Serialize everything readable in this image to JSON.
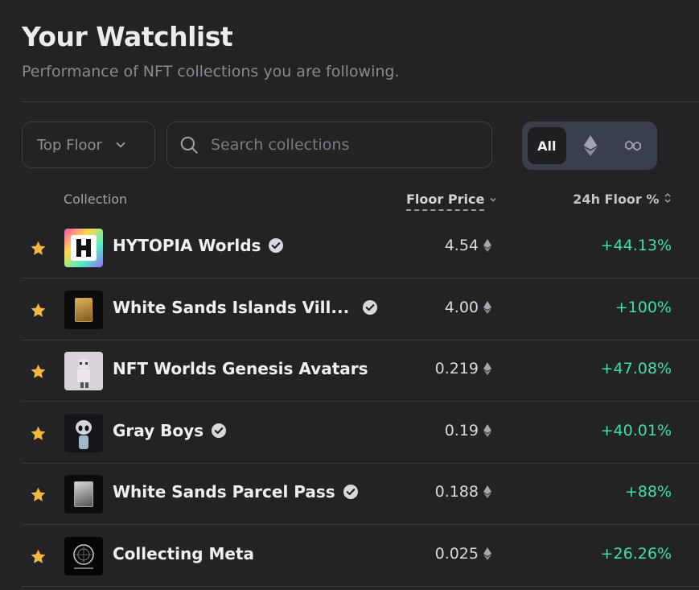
{
  "header": {
    "title": "Your Watchlist",
    "subtitle": "Performance of NFT collections you are following."
  },
  "controls": {
    "sort_label": "Top Floor",
    "search_placeholder": "Search collections",
    "chain_filter": {
      "all_label": "All",
      "selected": "All",
      "options": [
        "all",
        "ethereum-icon",
        "polygon-icon"
      ]
    }
  },
  "table": {
    "columns": {
      "collection": "Collection",
      "floor": "Floor Price",
      "change": "24h Floor %"
    },
    "rows": [
      {
        "name": "HYTOPIA Worlds",
        "verified": true,
        "floor": "4.54",
        "change": "+44.13%"
      },
      {
        "name": "White Sands Islands Vill...",
        "verified": true,
        "floor": "4.00",
        "change": "+100%"
      },
      {
        "name": "NFT Worlds Genesis Avatars",
        "verified": false,
        "floor": "0.219",
        "change": "+47.08%"
      },
      {
        "name": "Gray Boys",
        "verified": true,
        "floor": "0.19",
        "change": "+40.01%"
      },
      {
        "name": "White Sands Parcel Pass",
        "verified": true,
        "floor": "0.188",
        "change": "+88%"
      },
      {
        "name": "Collecting Meta",
        "verified": false,
        "floor": "0.025",
        "change": "+26.26%"
      }
    ]
  },
  "colors": {
    "positive": "#3fe0a3",
    "star": "#f5b83d",
    "background": "#232325"
  }
}
